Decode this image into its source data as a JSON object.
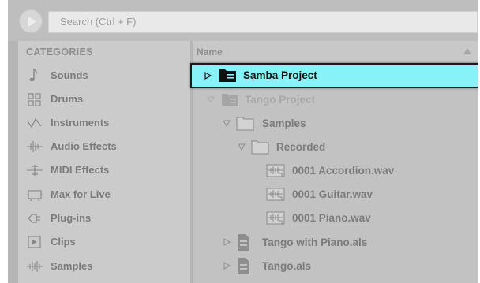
{
  "search": {
    "placeholder": "Search (Ctrl + F)"
  },
  "sidebar": {
    "header": "CATEGORIES",
    "items": [
      {
        "label": "Sounds",
        "icon": "note-icon"
      },
      {
        "label": "Drums",
        "icon": "drum-grid-icon"
      },
      {
        "label": "Instruments",
        "icon": "wave-icon"
      },
      {
        "label": "Audio Effects",
        "icon": "audio-effects-icon"
      },
      {
        "label": "MIDI Effects",
        "icon": "midi-effects-icon"
      },
      {
        "label": "Max for Live",
        "icon": "max-for-live-icon"
      },
      {
        "label": "Plug-ins",
        "icon": "plugin-icon"
      },
      {
        "label": "Clips",
        "icon": "clip-icon"
      },
      {
        "label": "Samples",
        "icon": "sample-icon"
      }
    ]
  },
  "browser": {
    "column_header": "Name",
    "rows": [
      {
        "label": "Samba Project",
        "type": "project",
        "expanded": false,
        "selected": true
      },
      {
        "label": "Tango Project",
        "type": "project",
        "expanded": true,
        "dim": true
      },
      {
        "label": "Samples",
        "type": "folder",
        "expanded": true
      },
      {
        "label": "Recorded",
        "type": "folder",
        "expanded": true
      },
      {
        "label": "0001 Accordion.wav",
        "type": "audio"
      },
      {
        "label": "0001 Guitar.wav",
        "type": "audio"
      },
      {
        "label": "0001 Piano.wav",
        "type": "audio"
      },
      {
        "label": "Tango with Piano.als",
        "type": "live-set",
        "expanded": false
      },
      {
        "label": "Tango.als",
        "type": "live-set",
        "expanded": false
      }
    ]
  },
  "colors": {
    "selection": "#87f2f7",
    "sidebar_bg": "#cbcbcb",
    "main_bg": "#c2c2c2"
  }
}
